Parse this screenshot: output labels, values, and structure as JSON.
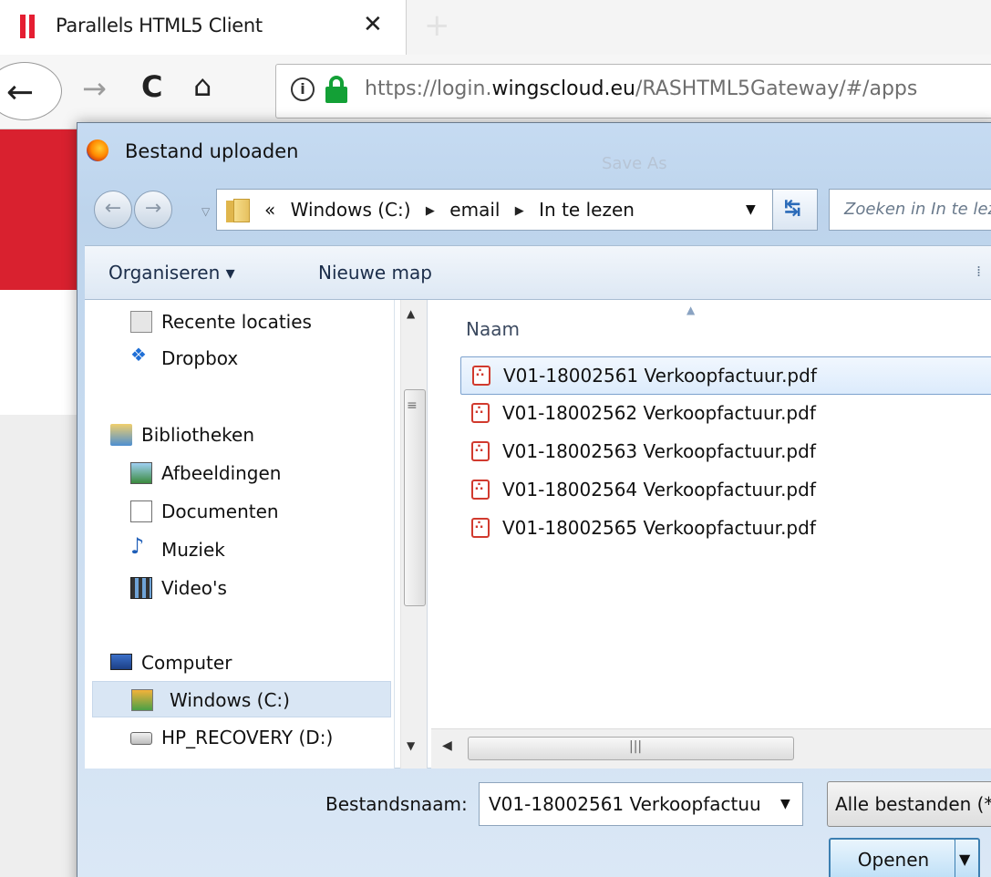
{
  "browser": {
    "tab_title": "Parallels HTML5 Client",
    "tab_close": "✕",
    "new_tab": "+",
    "url_prefix": "https://login.",
    "url_domain": "wingscloud.eu",
    "url_path": "/RASHTML5Gateway/#/apps",
    "brand_color": "#e51e32",
    "lock_color": "#13a036"
  },
  "dialog": {
    "title": "Bestand uploaden",
    "ghost_title": "Save As",
    "breadcrumb": [
      "«",
      "Windows  (C:)",
      "email",
      "In te lezen"
    ],
    "search_placeholder": "Zoeken in In te lezen",
    "toolbar": {
      "organize": "Organiseren ▾",
      "new_folder": "Nieuwe map"
    },
    "nav_items": [
      {
        "label": "Recente locaties",
        "icon": "recent-places-icon"
      },
      {
        "label": "Dropbox",
        "icon": "dropbox-icon"
      },
      {
        "label": "Bibliotheken",
        "icon": "libraries-icon"
      },
      {
        "label": "Afbeeldingen",
        "icon": "pictures-icon"
      },
      {
        "label": "Documenten",
        "icon": "documents-icon"
      },
      {
        "label": "Muziek",
        "icon": "music-icon"
      },
      {
        "label": "Video's",
        "icon": "videos-icon"
      },
      {
        "label": "Computer",
        "icon": "computer-icon"
      },
      {
        "label": "Windows  (C:)",
        "icon": "windows-drive-icon",
        "selected": true
      },
      {
        "label": "HP_RECOVERY (D:)",
        "icon": "drive-icon"
      }
    ],
    "column_header": "Naam",
    "files": [
      {
        "name": "V01-18002561 Verkoopfactuur.pdf",
        "selected": true
      },
      {
        "name": "V01-18002562 Verkoopfactuur.pdf"
      },
      {
        "name": "V01-18002563 Verkoopfactuur.pdf"
      },
      {
        "name": "V01-18002564 Verkoopfactuur.pdf"
      },
      {
        "name": "V01-18002565 Verkoopfactuur.pdf"
      }
    ],
    "filename_label": "Bestandsnaam:",
    "filename_value": "V01-18002561 Verkoopfactuu",
    "filetype_value": "Alle bestanden (*.*)",
    "open_label": "Openen"
  }
}
